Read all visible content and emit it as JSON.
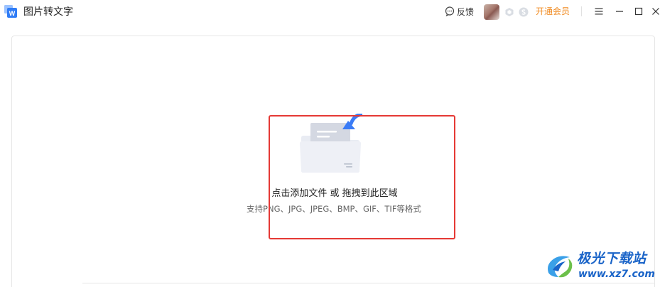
{
  "app": {
    "title": "图片转文字",
    "logo_letter": "W"
  },
  "header": {
    "feedback_label": "反馈",
    "vip_label": "开通会员"
  },
  "dropzone": {
    "title": "点击添加文件 或 拖拽到此区域",
    "hint": "支持PNG、JPG、JPEG、BMP、GIF、TIF等格式"
  },
  "watermark": {
    "name": "极光下载站",
    "url": "www.xz7.com"
  },
  "colors": {
    "accent_blue": "#3b7cf6",
    "vip_orange": "#f0891e",
    "highlight_red": "#e53935",
    "watermark_blue": "#1a64c8"
  },
  "icons": {
    "logo": "app-logo-icon",
    "feedback": "chat-bubble-icon",
    "menu": "hamburger-icon",
    "minimize": "minimize-icon",
    "maximize": "maximize-icon",
    "close": "close-icon",
    "folder": "folder-upload-icon"
  }
}
